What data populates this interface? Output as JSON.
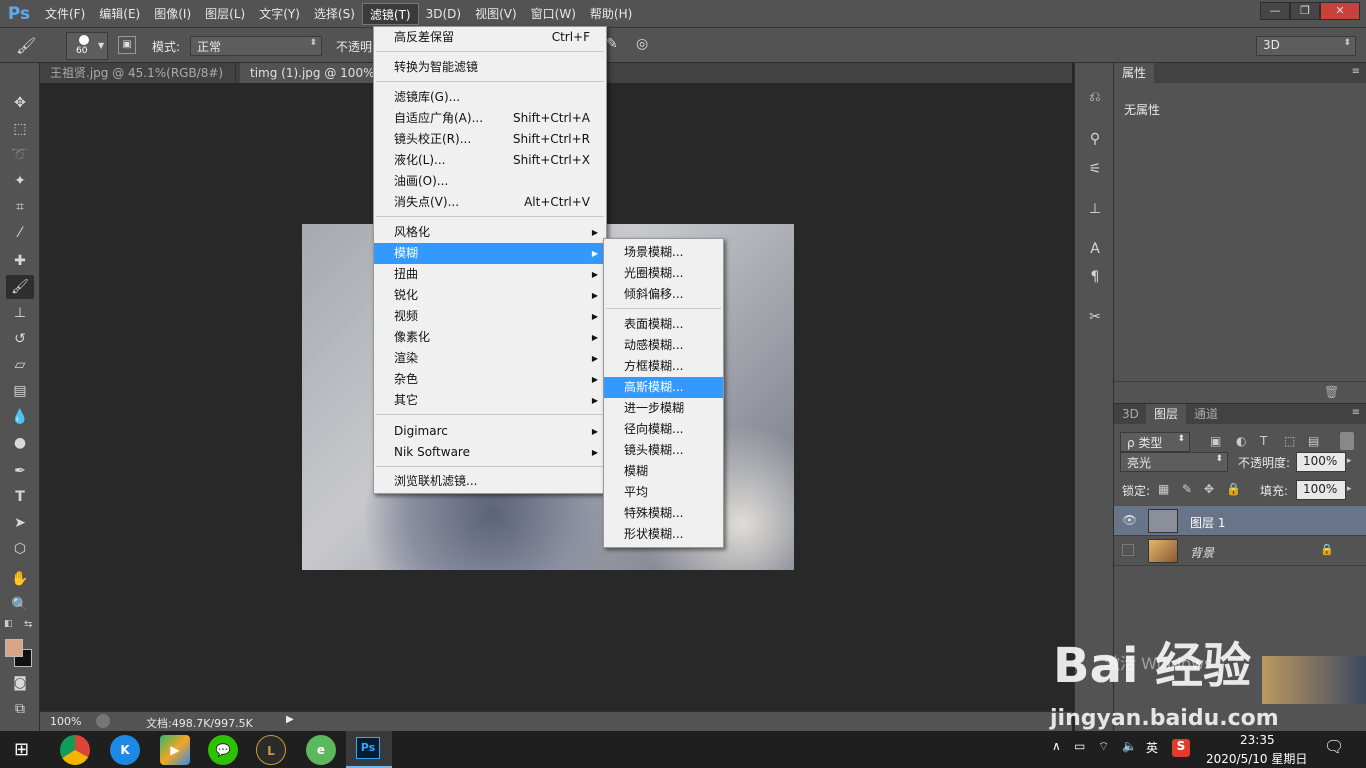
{
  "app": {
    "logo": "Ps",
    "menus": [
      "文件(F)",
      "编辑(E)",
      "图像(I)",
      "图层(L)",
      "文字(Y)",
      "选择(S)",
      "滤镜(T)",
      "3D(D)",
      "视图(V)",
      "窗口(W)",
      "帮助(H)"
    ],
    "active_menu": "滤镜(T)",
    "window_buttons": [
      "—",
      "❐",
      "✕"
    ]
  },
  "options": {
    "brush_size": "60",
    "mode_label": "模式:",
    "mode_value": "正常",
    "opacity_label": "不透明",
    "workspace": "3D"
  },
  "tabs": [
    {
      "label": "王祖贤.jpg @ 45.1%(RGB/8#) *",
      "close": "×"
    },
    {
      "label": "timg (1).jpg @ 100% (R",
      "close": ""
    }
  ],
  "filter_menu": {
    "items": [
      {
        "label": "高反差保留",
        "shortcut": "Ctrl+F"
      },
      {
        "label": "转换为智能滤镜",
        "shortcut": ""
      },
      {
        "label": "滤镜库(G)...",
        "shortcut": ""
      },
      {
        "label": "自适应广角(A)...",
        "shortcut": "Shift+Ctrl+A"
      },
      {
        "label": "镜头校正(R)...",
        "shortcut": "Shift+Ctrl+R"
      },
      {
        "label": "液化(L)...",
        "shortcut": "Shift+Ctrl+X"
      },
      {
        "label": "油画(O)...",
        "shortcut": ""
      },
      {
        "label": "消失点(V)...",
        "shortcut": "Alt+Ctrl+V"
      },
      {
        "label": "风格化",
        "shortcut": ""
      },
      {
        "label": "模糊",
        "shortcut": ""
      },
      {
        "label": "扭曲",
        "shortcut": ""
      },
      {
        "label": "锐化",
        "shortcut": ""
      },
      {
        "label": "视频",
        "shortcut": ""
      },
      {
        "label": "像素化",
        "shortcut": ""
      },
      {
        "label": "渲染",
        "shortcut": ""
      },
      {
        "label": "杂色",
        "shortcut": ""
      },
      {
        "label": "其它",
        "shortcut": ""
      },
      {
        "label": "Digimarc",
        "shortcut": ""
      },
      {
        "label": "Nik Software",
        "shortcut": ""
      },
      {
        "label": "浏览联机滤镜...",
        "shortcut": ""
      }
    ],
    "highlighted": "模糊"
  },
  "blur_submenu": {
    "items": [
      "场景模糊...",
      "光圈模糊...",
      "倾斜偏移...",
      "表面模糊...",
      "动感模糊...",
      "方框模糊...",
      "高斯模糊...",
      "进一步模糊",
      "径向模糊...",
      "镜头模糊...",
      "模糊",
      "平均",
      "特殊模糊...",
      "形状模糊..."
    ],
    "highlighted": "高斯模糊..."
  },
  "status": {
    "zoom": "100%",
    "doc_size": "文档:498.7K/997.5K"
  },
  "properties_panel": {
    "title": "属性",
    "content": "无属性"
  },
  "layers_panel": {
    "tabs": [
      "3D",
      "图层",
      "通道"
    ],
    "active_tab": "图层",
    "filter_label": "ρ 类型",
    "blend_mode": "亮光",
    "opacity_label": "不透明度:",
    "opacity_value": "100%",
    "lock_label": "锁定:",
    "fill_label": "填充:",
    "fill_value": "100%",
    "layers": [
      {
        "name": "图层 1",
        "visible": true,
        "selected": true,
        "locked": false
      },
      {
        "name": "背景",
        "visible": false,
        "selected": false,
        "locked": true
      }
    ]
  },
  "taskbar": {
    "tray_lang": "英",
    "time": "23:35",
    "date": "2020/5/10 星期日"
  },
  "watermark": {
    "brand": "Bai 经验",
    "url": "jingyan.baidu.com",
    "activate_text": "激活 Windows"
  },
  "colors": {
    "foreground": "#d6a58a",
    "background": "#111111",
    "highlight": "#3399ff",
    "ps_blue": "#5fa9e8"
  }
}
